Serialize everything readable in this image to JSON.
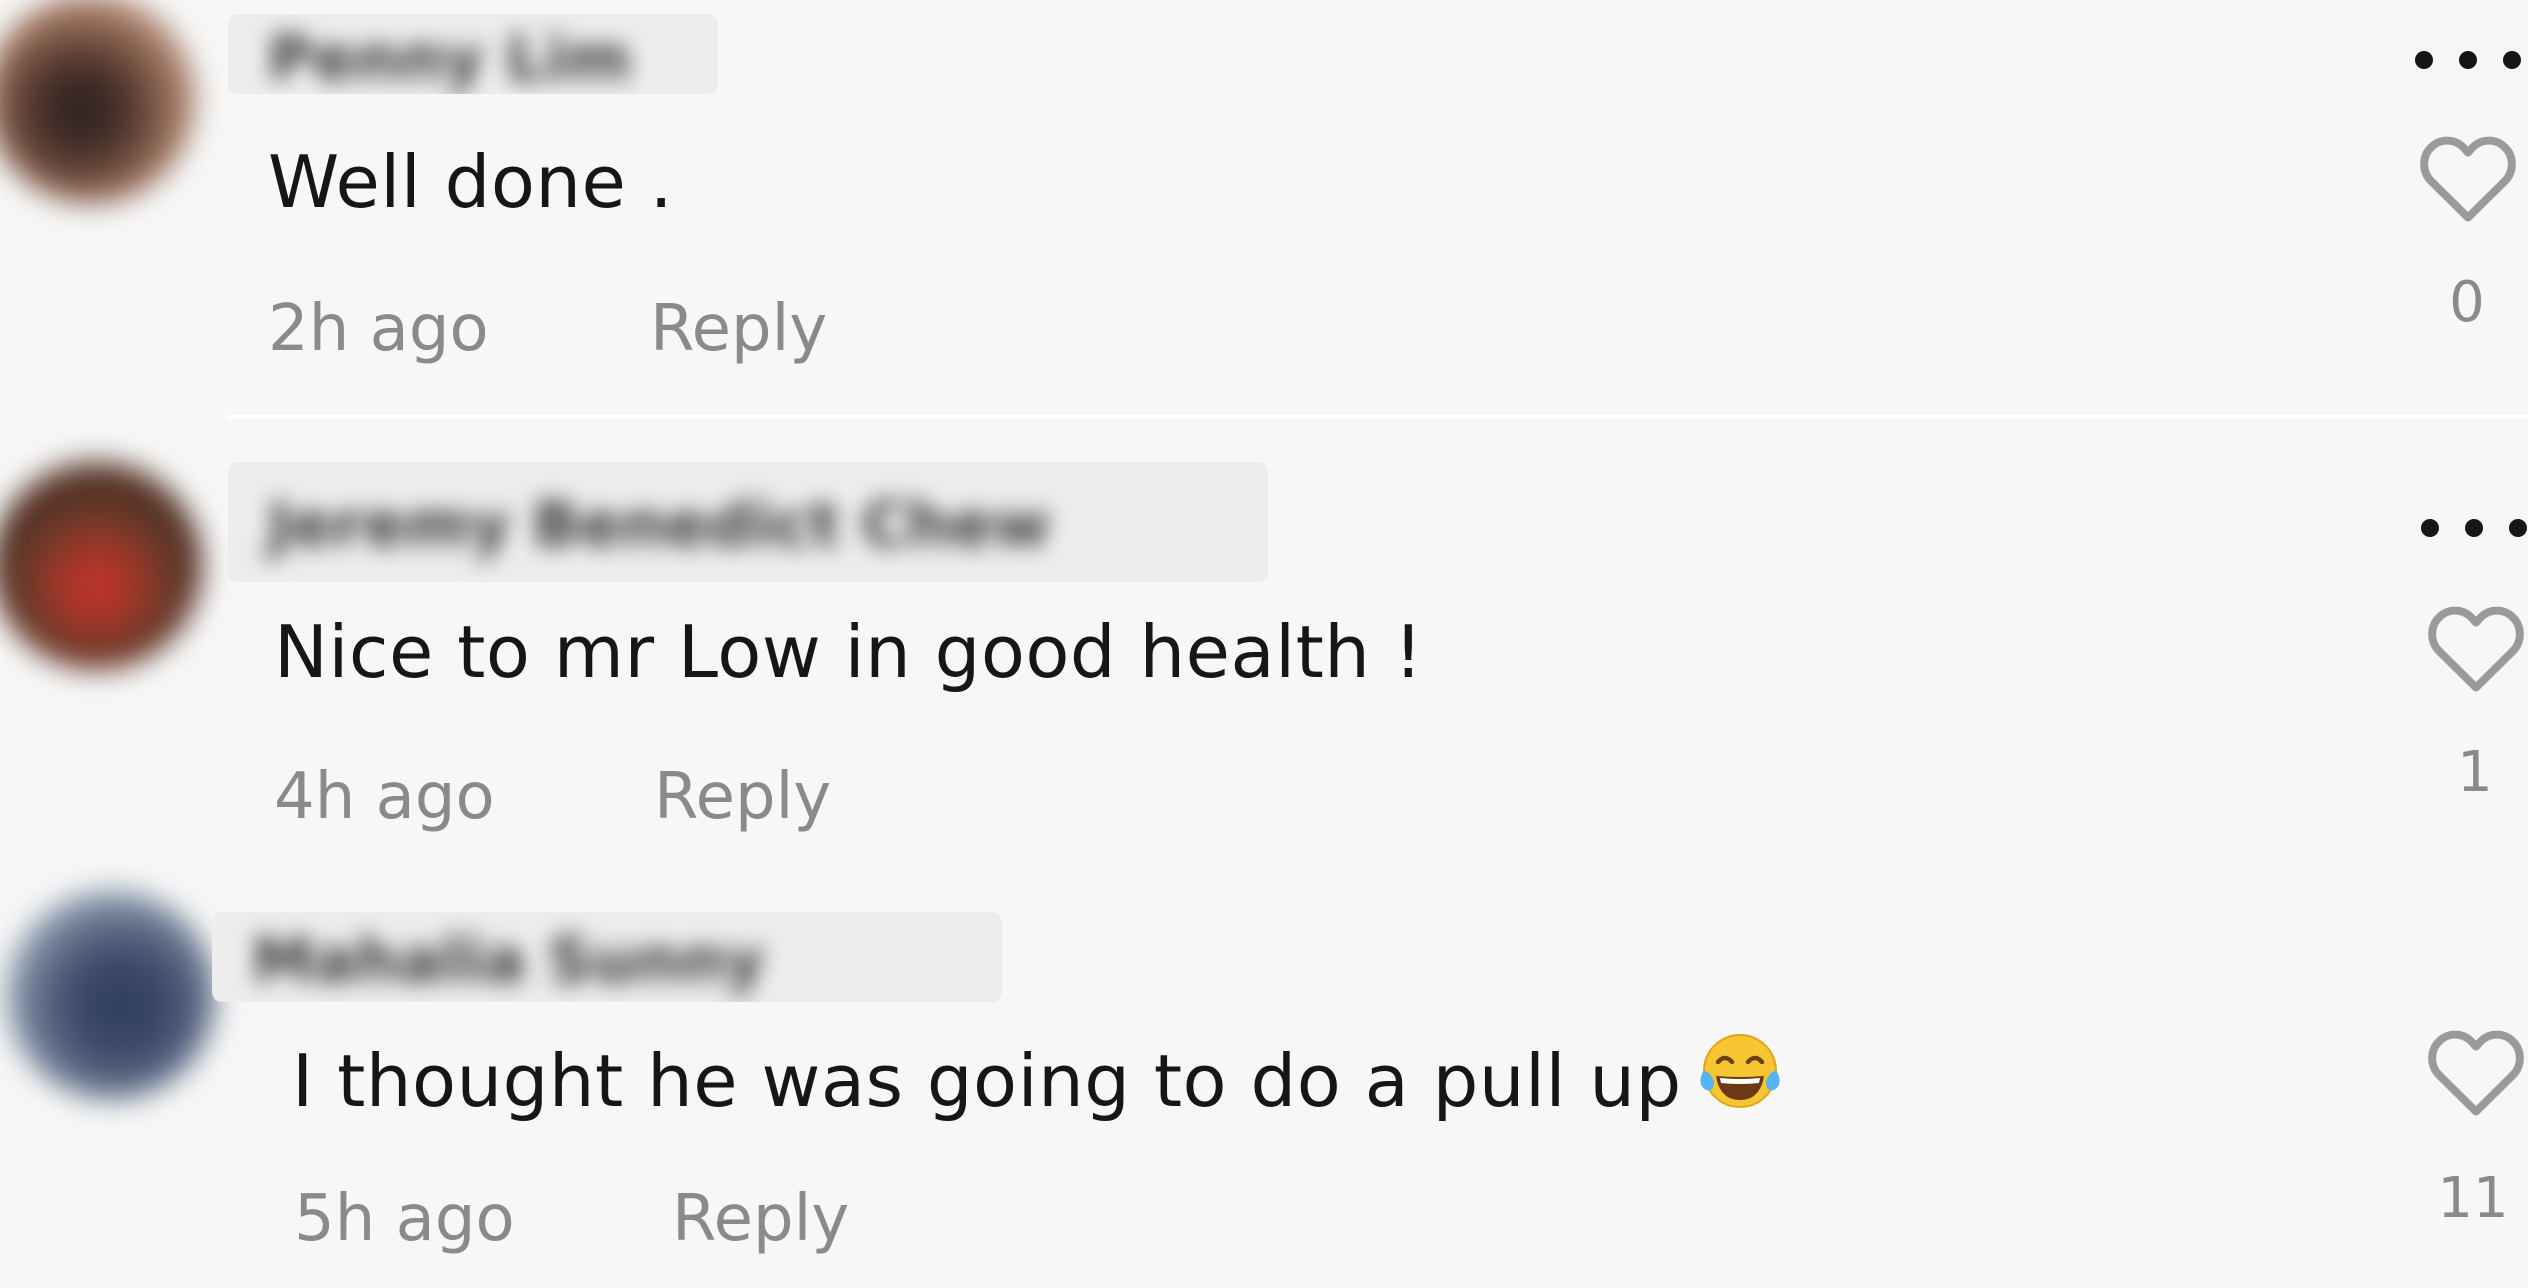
{
  "comments": [
    {
      "username": "Penny Lim",
      "text": "Well done .",
      "time": "2h ago",
      "reply_label": "Reply",
      "likes": "0",
      "has_more_menu": true
    },
    {
      "username": "Jeremy Benedict Chew",
      "text": "Nice to mr Low in good health !",
      "time": "4h ago",
      "reply_label": "Reply",
      "likes": "1",
      "has_more_menu": true
    },
    {
      "username": "Mahalia Sunny",
      "text": "I thought he was going to do a pull up",
      "emoji": "face-with-tears-of-joy",
      "time": "5h ago",
      "reply_label": "Reply",
      "likes": "11",
      "has_more_menu": false
    }
  ],
  "colors": {
    "background": "#f7f7f7",
    "comment_text": "#161616",
    "meta_text": "#8a8a8a",
    "icon_stroke": "#9a9a9a",
    "dots": "#161616"
  },
  "icons": {
    "like": "heart-outline-icon",
    "more": "more-horizontal-icon"
  }
}
